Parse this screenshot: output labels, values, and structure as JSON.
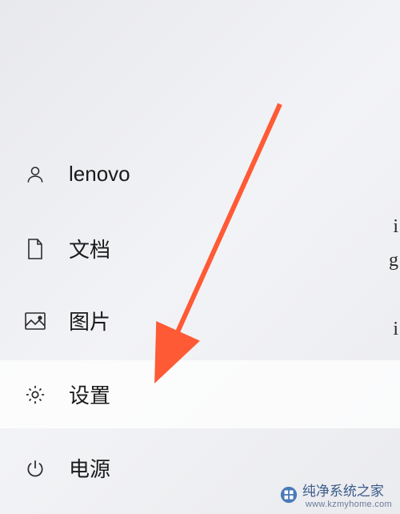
{
  "menu": {
    "user": {
      "label": "lenovo"
    },
    "documents": {
      "label": "文档"
    },
    "pictures": {
      "label": "图片"
    },
    "settings": {
      "label": "设置"
    },
    "power": {
      "label": "电源"
    }
  },
  "watermark": {
    "text": "纯净系统之家",
    "url": "www.kzmyhome.com"
  },
  "edge_chars": {
    "c1": "i",
    "c2": "g",
    "c3": "i"
  }
}
